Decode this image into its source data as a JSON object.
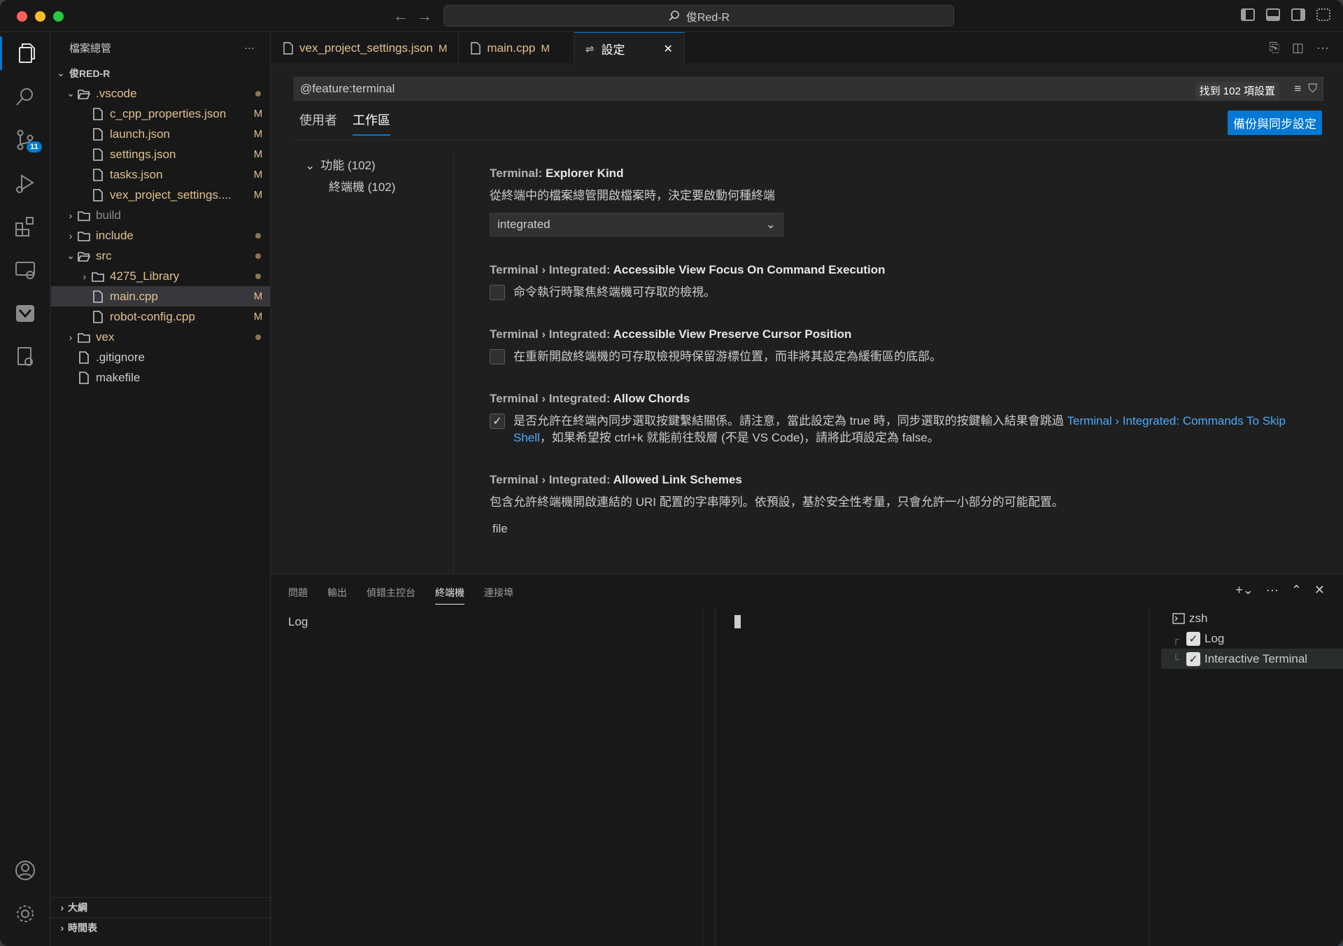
{
  "titlebar": {
    "search_text": "俊Red-R"
  },
  "explorer": {
    "title": "檔案總管",
    "more": "···",
    "root": "俊RED-R",
    "items": [
      {
        "label": ".vscode",
        "depth": 1,
        "kind": "folder-open",
        "mod": "dot",
        "color": "modified"
      },
      {
        "label": "c_cpp_properties.json",
        "depth": 2,
        "kind": "file",
        "mod": "M",
        "color": "modified"
      },
      {
        "label": "launch.json",
        "depth": 2,
        "kind": "file",
        "mod": "M",
        "color": "modified"
      },
      {
        "label": "settings.json",
        "depth": 2,
        "kind": "file",
        "mod": "M",
        "color": "modified"
      },
      {
        "label": "tasks.json",
        "depth": 2,
        "kind": "file",
        "mod": "M",
        "color": "modified"
      },
      {
        "label": "vex_project_settings....",
        "depth": 2,
        "kind": "file",
        "mod": "M",
        "color": "modified"
      },
      {
        "label": "build",
        "depth": 1,
        "kind": "folder",
        "mod": "",
        "color": "muted"
      },
      {
        "label": "include",
        "depth": 1,
        "kind": "folder",
        "mod": "dot",
        "color": "modified"
      },
      {
        "label": "src",
        "depth": 1,
        "kind": "folder-open",
        "mod": "dot",
        "color": "modified"
      },
      {
        "label": "4275_Library",
        "depth": 2,
        "kind": "folder",
        "mod": "dot",
        "color": "modified"
      },
      {
        "label": "main.cpp",
        "depth": 2,
        "kind": "file",
        "mod": "M",
        "color": "modified",
        "selected": true
      },
      {
        "label": "robot-config.cpp",
        "depth": 2,
        "kind": "file",
        "mod": "M",
        "color": "modified"
      },
      {
        "label": "vex",
        "depth": 1,
        "kind": "folder",
        "mod": "dot",
        "color": "modified"
      },
      {
        "label": ".gitignore",
        "depth": 1,
        "kind": "file",
        "mod": "",
        "color": "plain"
      },
      {
        "label": "makefile",
        "depth": 1,
        "kind": "file",
        "mod": "",
        "color": "plain"
      }
    ],
    "outline": "大綱",
    "timeline": "時間表"
  },
  "activity": {
    "scm_badge": "11"
  },
  "tabs": [
    {
      "label": "vex_project_settings.json",
      "mod": "M"
    },
    {
      "label": "main.cpp",
      "mod": "M"
    },
    {
      "label": "設定",
      "mod": "",
      "active": true,
      "close": "✕"
    }
  ],
  "settings": {
    "search": "@feature:terminal",
    "result_count": "找到 102 項設置",
    "scope_user": "使用者",
    "scope_workspace": "工作區",
    "sync_button": "備份與同步設定",
    "toc_feature": "功能 (102)",
    "toc_terminal": "終端機 (102)",
    "s1_cat": "Terminal: ",
    "s1_name": "Explorer Kind",
    "s1_desc": "從終端中的檔案總管開啟檔案時，決定要啟動何種終端",
    "s1_value": "integrated",
    "s2_cat": "Terminal › Integrated: ",
    "s2_name": "Accessible View Focus On Command Execution",
    "s2_desc": "命令執行時聚焦終端機可存取的檢視。",
    "s3_cat": "Terminal › Integrated: ",
    "s3_name": "Accessible View Preserve Cursor Position",
    "s3_desc": "在重新開啟終端機的可存取檢視時保留游標位置，而非將其設定為緩衝區的底部。",
    "s4_cat": "Terminal › Integrated: ",
    "s4_name": "Allow Chords",
    "s4_desc_a": "是否允許在終端內同步選取按鍵繫結關係。請注意，當此設定為 true 時，同步選取的按鍵輸入結果會跳過 ",
    "s4_link": "Terminal › Integrated: Commands To Skip Shell",
    "s4_desc_b": "，如果希望按 ctrl+k 就能前往殼層 (不是 VS Code)，請將此項設定為 false。",
    "s5_cat": "Terminal › Integrated: ",
    "s5_name": "Allowed Link Schemes",
    "s5_desc": "包含允許終端機開啟連結的 URI 配置的字串陣列。依預設，基於安全性考量，只會允許一小部分的可能配置。",
    "s5_value": "file"
  },
  "panel": {
    "tabs": [
      "問題",
      "輸出",
      "偵錯主控台",
      "終端機",
      "連接埠"
    ],
    "active_tab": "終端機",
    "log_text": "Log",
    "terminals": [
      {
        "label": "zsh",
        "icon": "terminal-icon"
      },
      {
        "label": "Log",
        "checked": true
      },
      {
        "label": "Interactive Terminal",
        "checked": true,
        "selected": true
      }
    ]
  },
  "colors": {
    "accent": "#0078d4",
    "modified": "#e2c08d",
    "link": "#4daafc"
  }
}
